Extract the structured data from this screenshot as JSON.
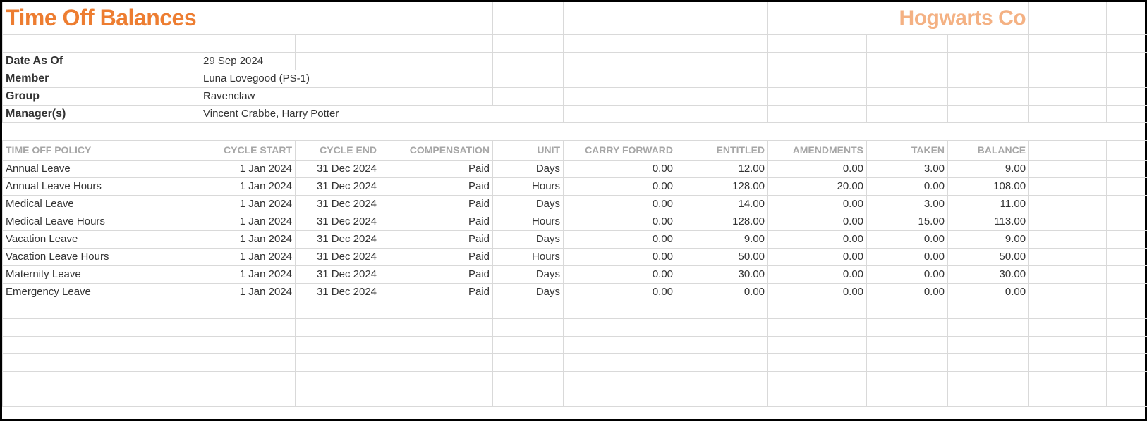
{
  "header": {
    "title": "Time Off Balances",
    "company": "Hogwarts Co"
  },
  "meta": {
    "date_label": "Date As Of",
    "date_value": "29 Sep 2024",
    "member_label": "Member",
    "member_value": "Luna Lovegood (PS-1)",
    "group_label": "Group",
    "group_value": "Ravenclaw",
    "managers_label": "Manager(s)",
    "managers_value": "Vincent Crabbe, Harry Potter"
  },
  "columns": {
    "policy": "TIME OFF POLICY",
    "cycle_start": "CYCLE START",
    "cycle_end": "CYCLE END",
    "compensation": "COMPENSATION",
    "unit": "UNIT",
    "carry_forward": "CARRY FORWARD",
    "entitled": "ENTITLED",
    "amendments": "AMENDMENTS",
    "taken": "TAKEN",
    "balance": "BALANCE"
  },
  "rows": [
    {
      "policy": "Annual Leave",
      "start": "1 Jan 2024",
      "end": "31 Dec 2024",
      "comp": "Paid",
      "unit": "Days",
      "carry": "0.00",
      "ent": "12.00",
      "amend": "0.00",
      "taken": "3.00",
      "bal": "9.00"
    },
    {
      "policy": "Annual Leave Hours",
      "start": "1 Jan 2024",
      "end": "31 Dec 2024",
      "comp": "Paid",
      "unit": "Hours",
      "carry": "0.00",
      "ent": "128.00",
      "amend": "20.00",
      "taken": "0.00",
      "bal": "108.00"
    },
    {
      "policy": "Medical Leave",
      "start": "1 Jan 2024",
      "end": "31 Dec 2024",
      "comp": "Paid",
      "unit": "Days",
      "carry": "0.00",
      "ent": "14.00",
      "amend": "0.00",
      "taken": "3.00",
      "bal": "11.00"
    },
    {
      "policy": "Medical Leave Hours",
      "start": "1 Jan 2024",
      "end": "31 Dec 2024",
      "comp": "Paid",
      "unit": "Hours",
      "carry": "0.00",
      "ent": "128.00",
      "amend": "0.00",
      "taken": "15.00",
      "bal": "113.00"
    },
    {
      "policy": "Vacation Leave",
      "start": "1 Jan 2024",
      "end": "31 Dec 2024",
      "comp": "Paid",
      "unit": "Days",
      "carry": "0.00",
      "ent": "9.00",
      "amend": "0.00",
      "taken": "0.00",
      "bal": "9.00"
    },
    {
      "policy": "Vacation Leave Hours",
      "start": "1 Jan 2024",
      "end": "31 Dec 2024",
      "comp": "Paid",
      "unit": "Hours",
      "carry": "0.00",
      "ent": "50.00",
      "amend": "0.00",
      "taken": "0.00",
      "bal": "50.00"
    },
    {
      "policy": "Maternity Leave",
      "start": "1 Jan 2024",
      "end": "31 Dec 2024",
      "comp": "Paid",
      "unit": "Days",
      "carry": "0.00",
      "ent": "30.00",
      "amend": "0.00",
      "taken": "0.00",
      "bal": "30.00"
    },
    {
      "policy": "Emergency Leave",
      "start": "1 Jan 2024",
      "end": "31 Dec 2024",
      "comp": "Paid",
      "unit": "Days",
      "carry": "0.00",
      "ent": "0.00",
      "amend": "0.00",
      "taken": "0.00",
      "bal": "0.00"
    }
  ]
}
